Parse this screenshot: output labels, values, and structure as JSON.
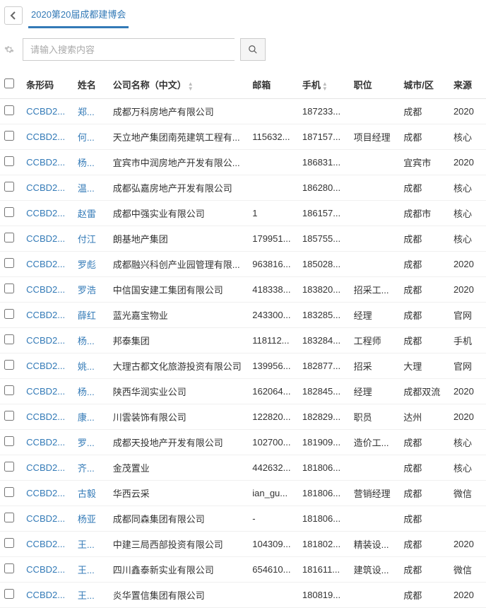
{
  "header": {
    "tab_label": "2020第20届成都建博会"
  },
  "search": {
    "placeholder": "请输入搜索内容"
  },
  "table": {
    "headers": {
      "barcode": "条形码",
      "name": "姓名",
      "company": "公司名称（中文）",
      "email": "邮箱",
      "phone": "手机",
      "position": "职位",
      "city": "城市/区",
      "source": "来源"
    },
    "rows": [
      {
        "barcode": "CCBD2...",
        "name": "郑...",
        "company": "成都万科房地产有限公司",
        "email": "",
        "phone": "187233...",
        "position": "",
        "city": "成都",
        "source": "2020"
      },
      {
        "barcode": "CCBD2...",
        "name": "何...",
        "company": "天立地产集团南苑建筑工程有...",
        "email": "115632...",
        "phone": "187157...",
        "position": "项目经理",
        "city": "成都",
        "source": "核心"
      },
      {
        "barcode": "CCBD2...",
        "name": "杨...",
        "company": "宜宾市中润房地产开发有限公...",
        "email": "",
        "phone": "186831...",
        "position": "",
        "city": "宜宾市",
        "source": "2020"
      },
      {
        "barcode": "CCBD2...",
        "name": "温...",
        "company": "成都弘嘉房地产开发有限公司",
        "email": "",
        "phone": "186280...",
        "position": "",
        "city": "成都",
        "source": "核心"
      },
      {
        "barcode": "CCBD2...",
        "name": "赵雷",
        "company": "成都中强实业有限公司",
        "email": "1",
        "phone": "186157...",
        "position": "",
        "city": "成都市",
        "source": "核心"
      },
      {
        "barcode": "CCBD2...",
        "name": "付江",
        "company": "朗基地产集团",
        "email": "179951...",
        "phone": "185755...",
        "position": "",
        "city": "成都",
        "source": "核心"
      },
      {
        "barcode": "CCBD2...",
        "name": "罗彪",
        "company": "成都融兴科创产业园管理有限...",
        "email": "963816...",
        "phone": "185028...",
        "position": "",
        "city": "成都",
        "source": "2020"
      },
      {
        "barcode": "CCBD2...",
        "name": "罗浩",
        "company": "中信国安建工集团有限公司",
        "email": "418338...",
        "phone": "183820...",
        "position": "招采工...",
        "city": "成都",
        "source": "2020"
      },
      {
        "barcode": "CCBD2...",
        "name": "薛红",
        "company": "蓝光嘉宝物业",
        "email": "243300...",
        "phone": "183285...",
        "position": "经理",
        "city": "成都",
        "source": "官网"
      },
      {
        "barcode": "CCBD2...",
        "name": "杨...",
        "company": "邦泰集团",
        "email": "118112...",
        "phone": "183284...",
        "position": "工程师",
        "city": "成都",
        "source": "手机"
      },
      {
        "barcode": "CCBD2...",
        "name": "姚...",
        "company": "大理古都文化旅游投资有限公司",
        "email": "139956...",
        "phone": "182877...",
        "position": "招采",
        "city": "大理",
        "source": "官网"
      },
      {
        "barcode": "CCBD2...",
        "name": "杨...",
        "company": "陕西华润实业公司",
        "email": "162064...",
        "phone": "182845...",
        "position": "经理",
        "city": "成都双流",
        "source": "2020"
      },
      {
        "barcode": "CCBD2...",
        "name": "康...",
        "company": "川雲装饰有限公司",
        "email": "122820...",
        "phone": "182829...",
        "position": "职员",
        "city": "达州",
        "source": "2020"
      },
      {
        "barcode": "CCBD2...",
        "name": "罗...",
        "company": "成都天投地产开发有限公司",
        "email": "102700...",
        "phone": "181909...",
        "position": "造价工...",
        "city": "成都",
        "source": "核心"
      },
      {
        "barcode": "CCBD2...",
        "name": "齐...",
        "company": "金茂置业",
        "email": "442632...",
        "phone": "181806...",
        "position": "",
        "city": "成都",
        "source": "核心"
      },
      {
        "barcode": "CCBD2...",
        "name": "古毅",
        "company": "华西云采",
        "email": "ian_gu...",
        "phone": "181806...",
        "position": "营销经理",
        "city": "成都",
        "source": "微信"
      },
      {
        "barcode": "CCBD2...",
        "name": "杨亚",
        "company": "成都同森集团有限公司",
        "email": "-",
        "phone": "181806...",
        "position": "",
        "city": "成都",
        "source": ""
      },
      {
        "barcode": "CCBD2...",
        "name": "王...",
        "company": "中建三局西部投资有限公司",
        "email": "104309...",
        "phone": "181802...",
        "position": "精装设...",
        "city": "成都",
        "source": "2020"
      },
      {
        "barcode": "CCBD2...",
        "name": "王...",
        "company": "四川鑫泰新实业有限公司",
        "email": "654610...",
        "phone": "181611...",
        "position": "建筑设...",
        "city": "成都",
        "source": "微信"
      },
      {
        "barcode": "CCBD2...",
        "name": "王...",
        "company": "炎华置信集团有限公司",
        "email": "",
        "phone": "180819...",
        "position": "",
        "city": "成都",
        "source": "2020"
      }
    ]
  }
}
